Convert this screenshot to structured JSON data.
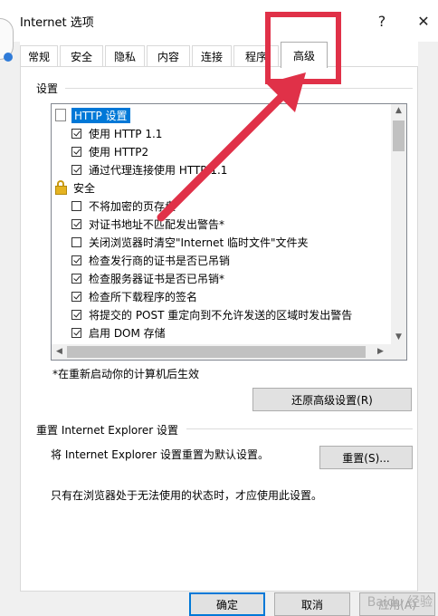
{
  "window": {
    "title": "Internet 选项",
    "help": "?",
    "close": "✕"
  },
  "tabs": [
    "常规",
    "安全",
    "隐私",
    "内容",
    "连接",
    "程序",
    "高级"
  ],
  "active_tab": "高级",
  "settings_group": "设置",
  "settings": [
    {
      "type": "header",
      "icon": "page-icon",
      "label": "HTTP 设置",
      "selected": true
    },
    {
      "type": "checkbox",
      "checked": true,
      "label": "使用 HTTP 1.1"
    },
    {
      "type": "checkbox",
      "checked": true,
      "label": "使用 HTTP2"
    },
    {
      "type": "checkbox",
      "checked": true,
      "label": "通过代理连接使用 HTTP 1.1"
    },
    {
      "type": "header",
      "icon": "lock-icon",
      "label": "安全"
    },
    {
      "type": "checkbox",
      "checked": false,
      "label": "不将加密的页存盘"
    },
    {
      "type": "checkbox",
      "checked": true,
      "label": "对证书地址不匹配发出警告*"
    },
    {
      "type": "checkbox",
      "checked": false,
      "label": "关闭浏览器时清空\"Internet 临时文件\"文件夹"
    },
    {
      "type": "checkbox",
      "checked": true,
      "label": "检查发行商的证书是否已吊销"
    },
    {
      "type": "checkbox",
      "checked": true,
      "label": "检查服务器证书是否已吊销*"
    },
    {
      "type": "checkbox",
      "checked": true,
      "label": "检查所下载程序的签名"
    },
    {
      "type": "checkbox",
      "checked": true,
      "label": "将提交的 POST 重定向到不允许发送的区域时发出警告"
    },
    {
      "type": "checkbox",
      "checked": true,
      "label": "启用 DOM 存储"
    }
  ],
  "restart_note": "*在重新启动你的计算机后生效",
  "restore_button": "还原高级设置(R)",
  "reset_group": "重置 Internet Explorer 设置",
  "reset_desc": "将 Internet Explorer 设置重置为默认设置。",
  "reset_button": "重置(S)...",
  "reset_note": "只有在浏览器处于无法使用的状态时，才应使用此设置。",
  "footer": {
    "ok": "确定",
    "cancel": "取消",
    "apply": "应用(A)"
  },
  "colors": {
    "annotation": "#e03148",
    "selection": "#0078d7"
  }
}
